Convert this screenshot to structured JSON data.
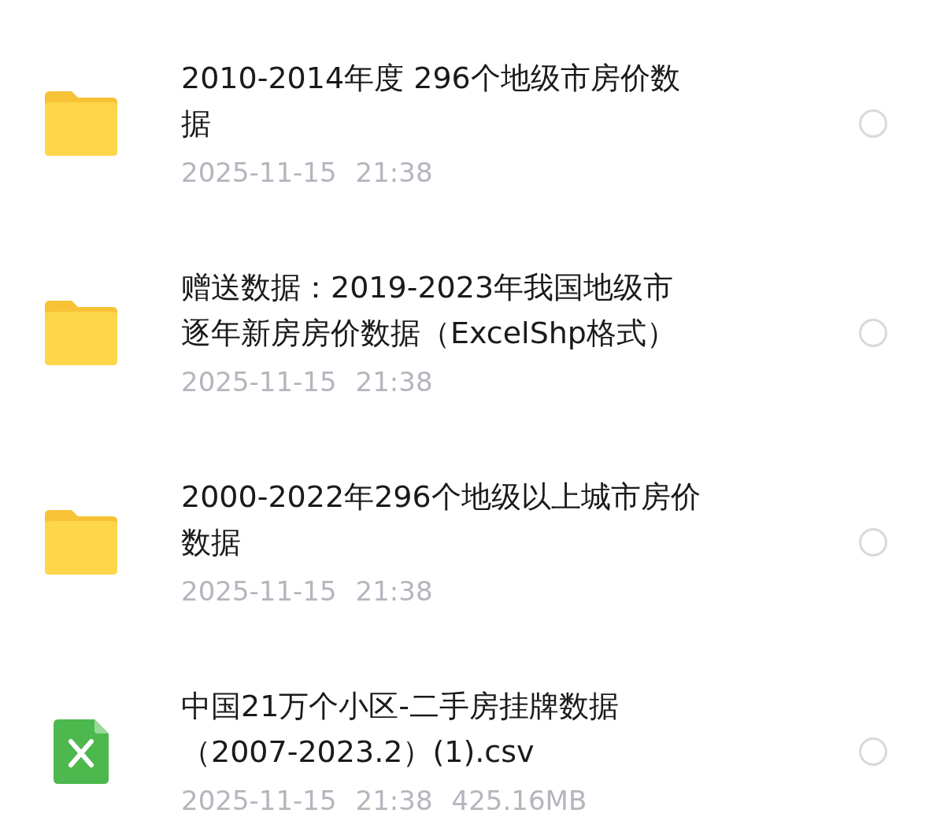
{
  "files": [
    {
      "kind": "folder",
      "title_lines": [
        "2010-2014年度 296个地级市房价数",
        "据"
      ],
      "date": "2025-11-15",
      "time": "21:38",
      "selected": false
    },
    {
      "kind": "folder",
      "title_lines": [
        "赠送数据：2019-2023年我国地级市",
        "逐年新房房价数据（ExcelShp格式）"
      ],
      "date": "2025-11-15",
      "time": "21:38",
      "selected": false
    },
    {
      "kind": "folder",
      "title_lines": [
        "2000-2022年296个地级以上城市房价",
        "数据"
      ],
      "date": "2025-11-15",
      "time": "21:38",
      "selected": false
    },
    {
      "kind": "spreadsheet",
      "title_lines": [
        "中国21万个小区-二手房挂牌数据",
        "（2007-2023.2）(1).csv"
      ],
      "date": "2025-11-15",
      "time": "21:38",
      "size": "425.16MB",
      "selected": false
    }
  ]
}
